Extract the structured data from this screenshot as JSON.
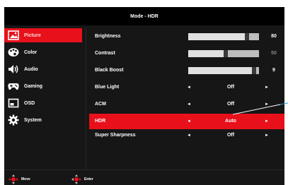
{
  "title": "Mode - HDR",
  "sidebar": {
    "items": [
      {
        "label": "Picture",
        "icon": "picture-icon"
      },
      {
        "label": "Color",
        "icon": "palette-icon"
      },
      {
        "label": "Audio",
        "icon": "speaker-icon"
      },
      {
        "label": "Gaming",
        "icon": "gamepad-icon"
      },
      {
        "label": "OSD",
        "icon": "osd-window-icon"
      },
      {
        "label": "System",
        "icon": "gear-icon"
      }
    ],
    "active": "Picture"
  },
  "settings": [
    {
      "label": "Brightness",
      "type": "slider",
      "value": "80",
      "level": 0.8
    },
    {
      "label": "Contrast",
      "type": "slider",
      "value": "50",
      "level": 0.5,
      "disabled": true
    },
    {
      "label": "Black Boost",
      "type": "slider",
      "value": "9",
      "level": 0.9
    },
    {
      "label": "Blue Light",
      "type": "select",
      "value": "Off"
    },
    {
      "label": "ACM",
      "type": "select",
      "value": "Off"
    },
    {
      "label": "HDR",
      "type": "select",
      "value": "Auto",
      "highlighted": true
    },
    {
      "label": "Super Sharpness",
      "type": "select",
      "value": "Off"
    }
  ],
  "arrows": {
    "left": "◄",
    "right": "►"
  },
  "footer": {
    "move_label": "Move",
    "enter_label": "Enter"
  },
  "colors": {
    "accent": "#e8101a",
    "background": "#161616",
    "titlebar": "#000000",
    "callout": "#2a9fd6"
  }
}
